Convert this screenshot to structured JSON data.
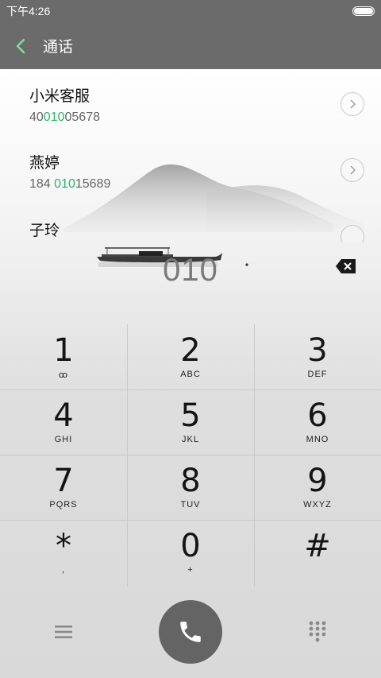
{
  "status_bar": {
    "time": "下午4:26"
  },
  "header": {
    "title": "通话"
  },
  "contacts": [
    {
      "name": "小米客服",
      "number_pre": "40",
      "number_match": "010",
      "number_post": "05678"
    },
    {
      "name": "燕婷",
      "number_pre": "184 ",
      "number_match": "010",
      "number_post": "15689"
    },
    {
      "name": "子玲"
    }
  ],
  "dial_input": "010",
  "keypad": [
    {
      "digit": "1",
      "letters": "ꝏ"
    },
    {
      "digit": "2",
      "letters": "ABC"
    },
    {
      "digit": "3",
      "letters": "DEF"
    },
    {
      "digit": "4",
      "letters": "GHI"
    },
    {
      "digit": "5",
      "letters": "JKL"
    },
    {
      "digit": "6",
      "letters": "MNO"
    },
    {
      "digit": "7",
      "letters": "PQRS"
    },
    {
      "digit": "8",
      "letters": "TUV"
    },
    {
      "digit": "9",
      "letters": "WXYZ"
    },
    {
      "digit": "*",
      "letters": ","
    },
    {
      "digit": "0",
      "letters": "+"
    },
    {
      "digit": "#",
      "letters": ""
    }
  ],
  "colors": {
    "header_bg": "#6b6b6b",
    "match_highlight": "#29b56a",
    "call_button": "#646464"
  },
  "icons": {
    "back": "chevron-left-icon",
    "info": "chevron-right-circle-icon",
    "delete": "backspace-icon",
    "menu": "hamburger-icon",
    "call": "phone-icon",
    "keypad": "dialpad-icon"
  }
}
